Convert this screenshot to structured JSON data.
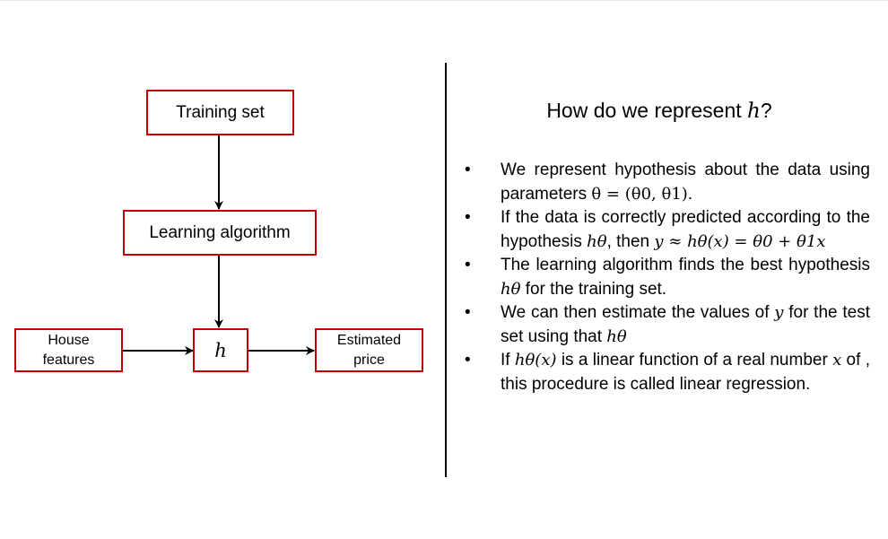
{
  "diagram": {
    "nodes": {
      "training_set": "Training set",
      "learning_algorithm": "Learning algorithm",
      "h": "h",
      "house_features_line1": "House",
      "house_features_line2": "features",
      "estimated_price_line1": "Estimated",
      "estimated_price_line2": "price"
    },
    "edges": [
      {
        "from": "Training set",
        "to": "Learning algorithm"
      },
      {
        "from": "Learning algorithm",
        "to": "h"
      },
      {
        "from": "House features",
        "to": "h"
      },
      {
        "from": "h",
        "to": "Estimated price"
      }
    ],
    "colors": {
      "box_border": "#c00000",
      "arrows": "#000000",
      "divider": "#000000"
    }
  },
  "right_panel": {
    "title_prefix": "How do we represent ",
    "title_math": "h",
    "title_suffix": "?",
    "bullet_symbol": "•",
    "bullets": {
      "b1": {
        "text": "We represent hypothesis about the data using parameters ",
        "math": "θ = (θ0, θ1)",
        "end": "."
      },
      "b2": {
        "text_a": "If the data is correctly predicted according to the hypothesis ",
        "math_a": "hθ",
        "text_b": ", then ",
        "math_b": "y ≈ hθ(x) = θ0 + θ1x"
      },
      "b3": {
        "text_a": "The learning algorithm finds the best hypothesis ",
        "math": "hθ",
        "text_b": " for the training set."
      },
      "b4": {
        "text_a": "We can then estimate the values of ",
        "math_a": "y",
        "text_b": " for the test set using that ",
        "math_b": "hθ"
      },
      "b5": {
        "text_a": "If ",
        "math_a": "hθ(x)",
        "text_b": " is a linear function of a real number ",
        "math_b": "x",
        "text_c": " of , this procedure is called linear regression."
      }
    }
  }
}
